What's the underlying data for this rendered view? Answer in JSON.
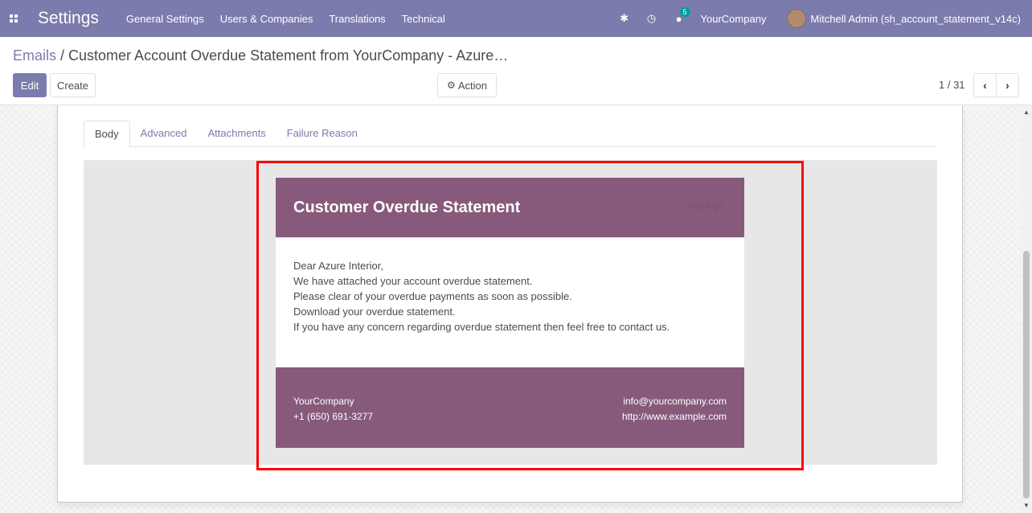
{
  "navbar": {
    "brand": "Settings",
    "menu": [
      "General Settings",
      "Users & Companies",
      "Translations",
      "Technical"
    ],
    "chat_badge": "5",
    "company": "YourCompany",
    "user": "Mitchell Admin (sh_account_statement_v14c)"
  },
  "breadcrumb": {
    "parent": "Emails",
    "separator": "/",
    "current": "Customer Account Overdue Statement from YourCompany - Azure…"
  },
  "buttons": {
    "edit": "Edit",
    "create": "Create",
    "action": "Action"
  },
  "pager": {
    "value": "1 / 31"
  },
  "tabs": [
    "Body",
    "Advanced",
    "Attachments",
    "Failure Reason"
  ],
  "email": {
    "title": "Customer Overdue Statement",
    "logo": "Your logo",
    "body_lines": [
      "Dear Azure Interior,",
      "We have attached your account overdue statement.",
      "Please clear of your overdue payments as soon as possible.",
      "Download your overdue statement.",
      "If you have any concern regarding overdue statement then feel free to contact us."
    ],
    "footer": {
      "company": "YourCompany",
      "phone": "+1 (650) 691-3277",
      "email": "info@yourcompany.com",
      "website": "http://www.example.com"
    }
  },
  "colors": {
    "navbar": "#7c7bad",
    "email_brand": "#875a7b",
    "highlight": "#ff0000"
  }
}
